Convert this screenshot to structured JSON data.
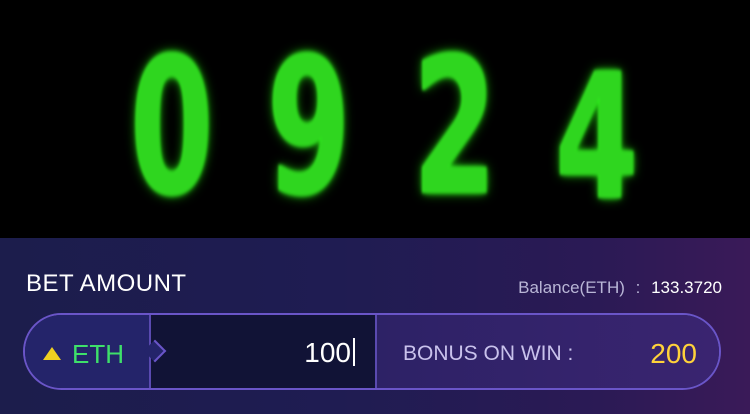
{
  "reel": {
    "digits": [
      "0",
      "9",
      "2",
      "4"
    ],
    "color": "#2fd61f"
  },
  "bet": {
    "label": "BET AMOUNT",
    "balance_label": "Balance(ETH)",
    "balance_sep": ":",
    "balance_value": "133.3720",
    "currency": "ETH",
    "currency_icon": "up-triangle-icon",
    "amount": "100",
    "bonus_label": "BONUS ON WIN :",
    "bonus_value": "200"
  },
  "colors": {
    "panel_bg": "#1f1c52",
    "accent_border": "#6a55c8",
    "currency_text": "#3ee06a",
    "bonus_value": "#ffd23a"
  }
}
